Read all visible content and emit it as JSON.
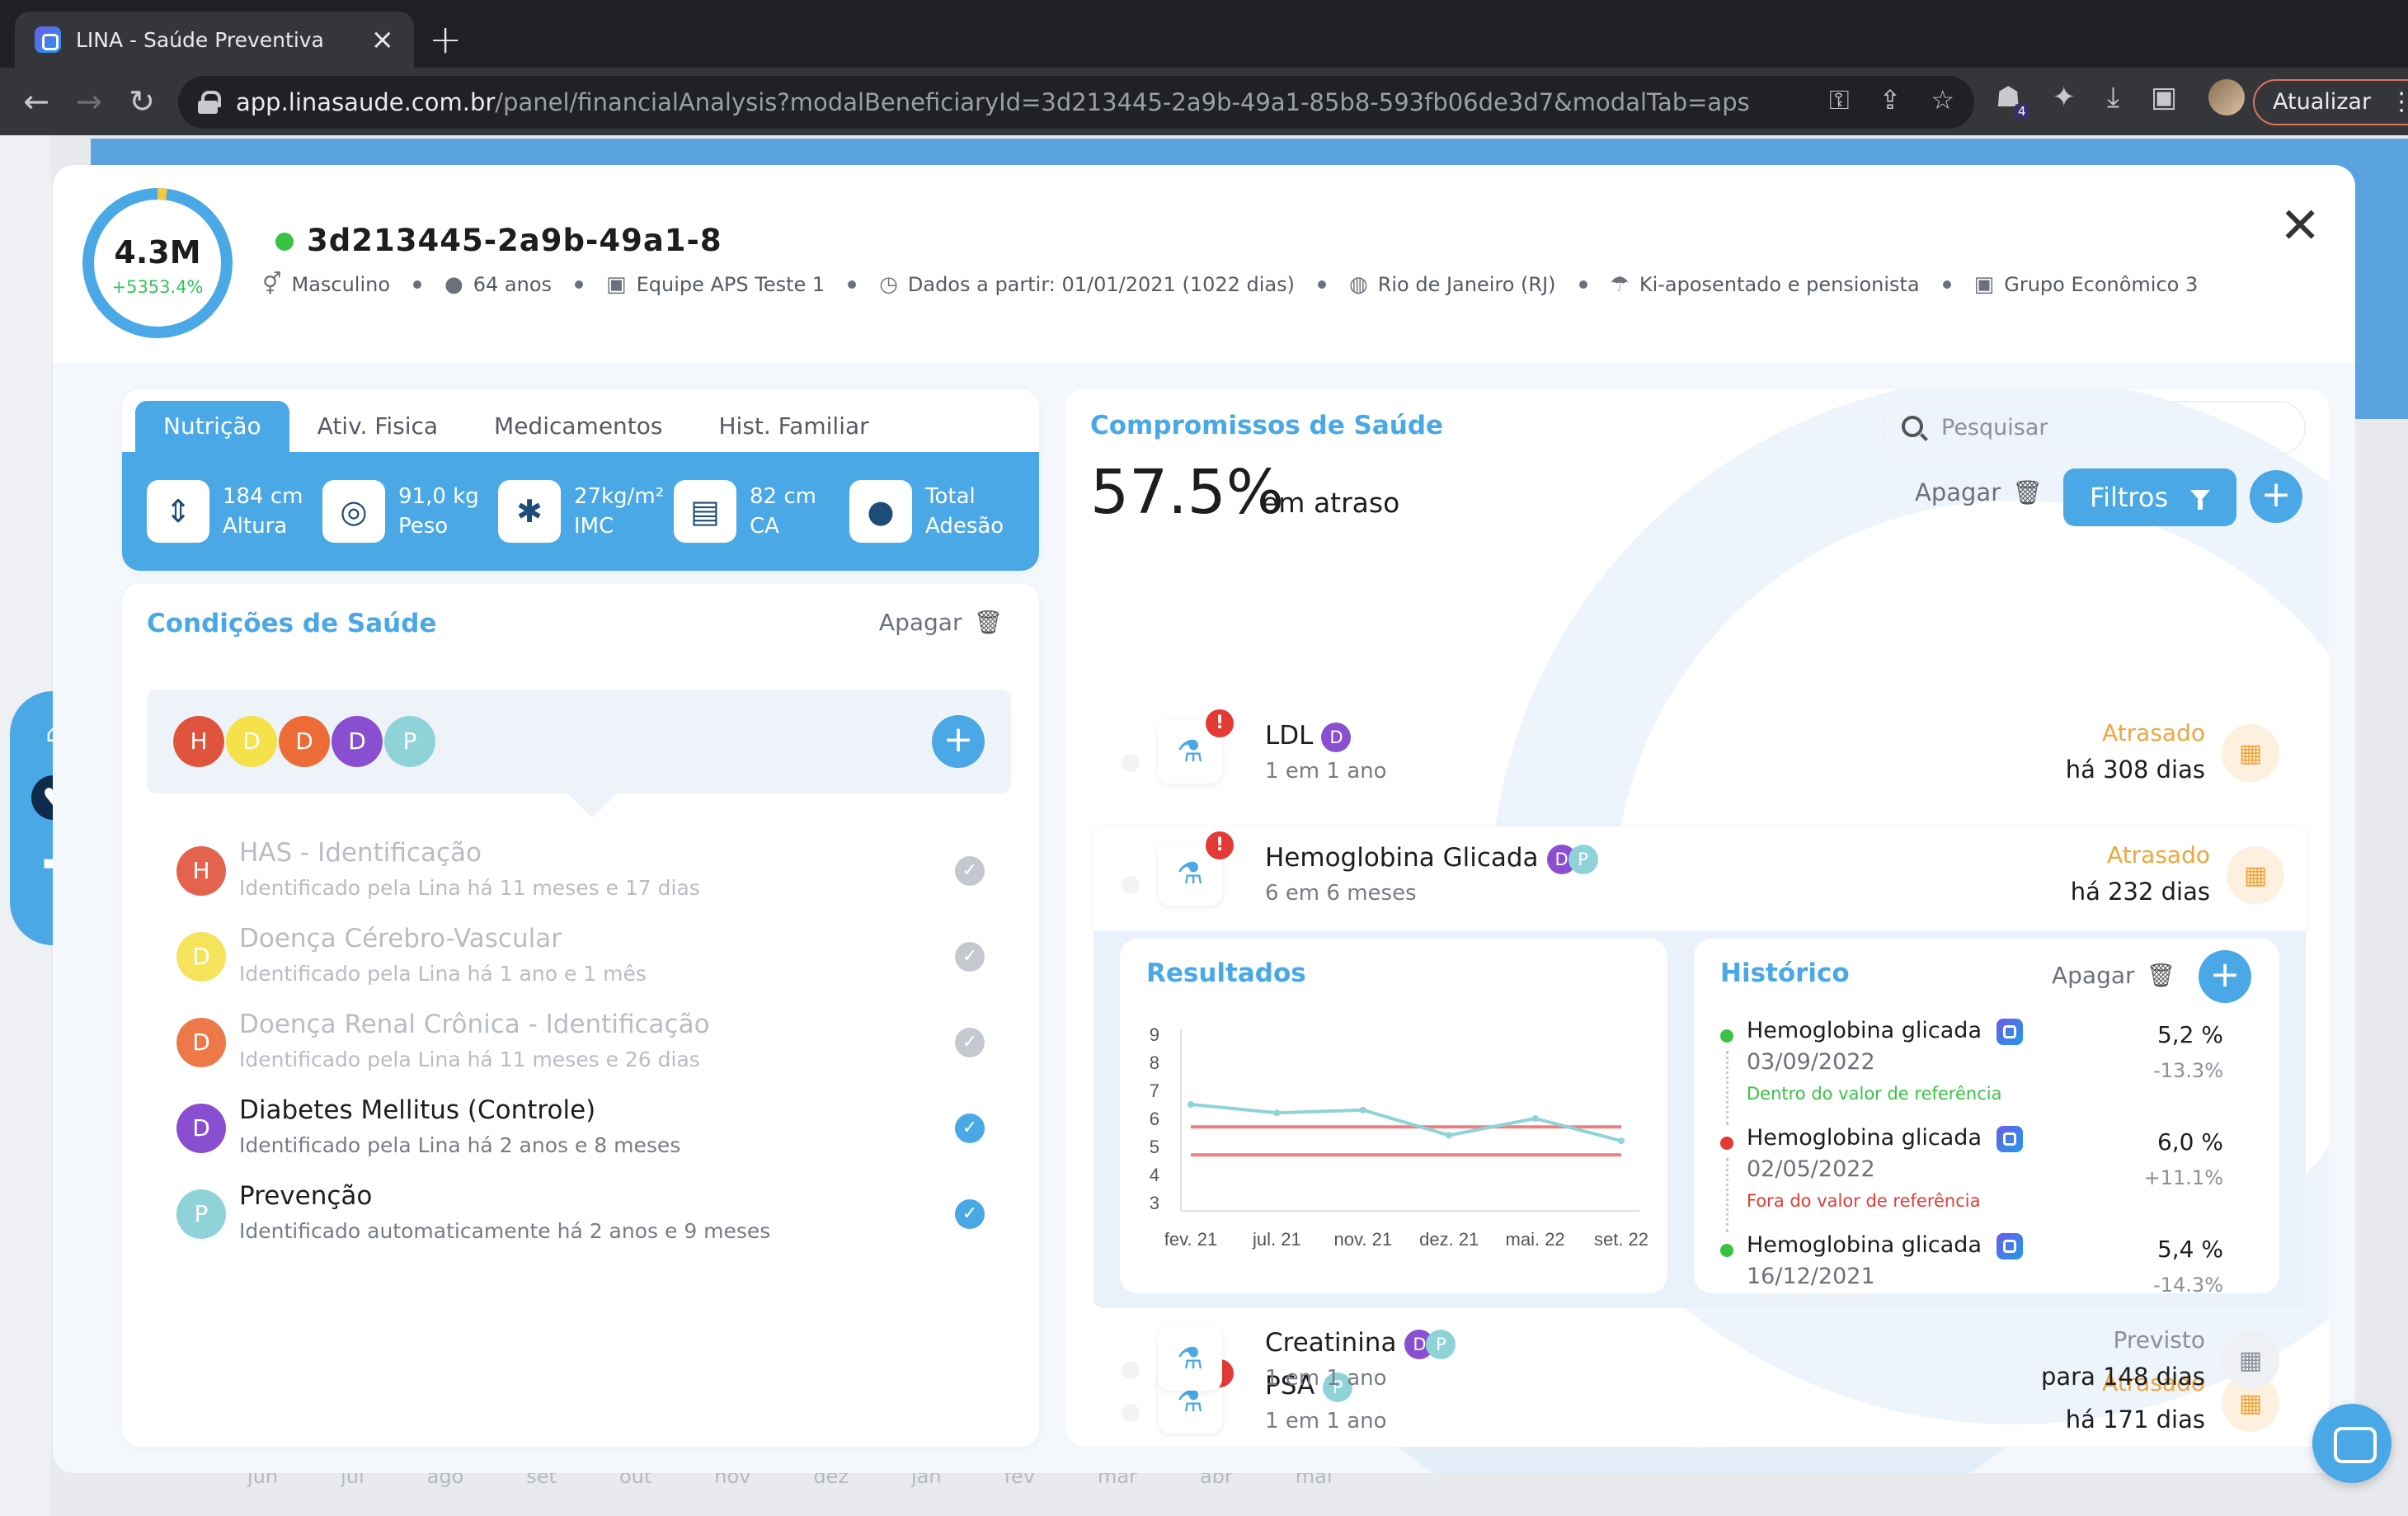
{
  "browser": {
    "tab_title": "LINA - Saúde Preventiva",
    "url_host": "app.linasaude.com.br",
    "url_path": "/panel/financialAnalysis?modalBeneficiaryId=3d213445-2a9b-49a1-85b8-593fb06de3d7&modalTab=aps",
    "update_label": "Atualizar",
    "extension_badge": "4"
  },
  "header": {
    "ring_value": "4.3M",
    "ring_delta": "+5353.4%",
    "beneficiary_id": "3d213445-2a9b-49a1-8",
    "meta": {
      "gender": "Masculino",
      "age": "64 anos",
      "team": "Equipe APS Teste 1",
      "data_from": "Dados a partir: 01/01/2021 (1022 dias)",
      "location": "Rio de Janeiro (RJ)",
      "plan": "Ki-aposentado e pensionista",
      "group": "Grupo Econômico 3"
    },
    "close_icon": "close-icon"
  },
  "left": {
    "tabs": [
      "Nutrição",
      "Ativ. Fisica",
      "Medicamentos",
      "Hist. Familiar"
    ],
    "metrics": [
      {
        "icon": "height-icon",
        "value": "184 cm",
        "label": "Altura"
      },
      {
        "icon": "scale-icon",
        "value": "91,0 kg",
        "label": "Peso"
      },
      {
        "icon": "person-icon",
        "value": "27kg/m²",
        "label": "IMC"
      },
      {
        "icon": "tape-icon",
        "value": "82 cm",
        "label": "CA"
      },
      {
        "icon": "apple-icon",
        "value": "Total",
        "label": "Adesão"
      }
    ],
    "conditions_title": "Condições de Saúde",
    "conditions_apagar": "Apagar",
    "circles": [
      "H",
      "D",
      "D",
      "D",
      "P"
    ],
    "conditions": [
      {
        "letter": "H",
        "title": "HAS - Identificação",
        "sub": "Identificado pela Lina há 11 meses e 17 dias"
      },
      {
        "letter": "D",
        "title": "Doença Cérebro-Vascular",
        "sub": "Identificado pela Lina há 1 ano e 1 mês"
      },
      {
        "letter": "D",
        "title": "Doença Renal Crônica - Identificação",
        "sub": "Identificado pela Lina há 11 meses e 26 dias"
      },
      {
        "letter": "D",
        "title": "Diabetes Mellitus (Controle)",
        "sub": "Identificado pela Lina há 2 anos e 8 meses"
      },
      {
        "letter": "P",
        "title": "Prevenção",
        "sub": "Identificado automaticamente há 2 anos e 9 meses"
      }
    ]
  },
  "right": {
    "title": "Compromissos de Saúde",
    "pct": "57.5%",
    "pct_label": "em atraso",
    "search_placeholder": "Pesquisar",
    "apagar": "Apagar",
    "filtros": "Filtros",
    "items": [
      {
        "name": "LDL",
        "freq": "1 em 1 ano",
        "status": "Atrasado",
        "detail": "há 308 dias",
        "badges": [
          "D"
        ]
      },
      {
        "name": "Hemoglobina Glicada",
        "freq": "6 em 6 meses",
        "status": "Atrasado",
        "detail": "há 232 dias",
        "badges": [
          "D",
          "P"
        ]
      },
      {
        "name": "PSA",
        "freq": "1 em 1 ano",
        "status": "Atrasado",
        "detail": "há 171 dias",
        "badges": [
          "P"
        ]
      },
      {
        "name": "Creatinina",
        "freq": "1 em 1 ano",
        "status": "Previsto",
        "detail": "para 148 dias",
        "badges": [
          "D",
          "P"
        ]
      }
    ],
    "results_title": "Resultados",
    "history_title": "Histórico",
    "history_apagar": "Apagar",
    "history": [
      {
        "name": "Hemoglobina glicada",
        "date": "03/09/2022",
        "status": "Dentro do valor de referência",
        "value": "5,2 %",
        "change": "-13.3%",
        "ok": true
      },
      {
        "name": "Hemoglobina glicada",
        "date": "02/05/2022",
        "status": "Fora do valor de referência",
        "value": "6,0 %",
        "change": "+11.1%",
        "ok": false
      },
      {
        "name": "Hemoglobina glicada",
        "date": "16/12/2021",
        "status": "",
        "value": "5,4 %",
        "change": "-14.3%",
        "ok": true
      }
    ]
  },
  "background_axis": [
    "jun",
    "jul",
    "ago",
    "set",
    "out",
    "nov",
    "dez",
    "jan",
    "fev",
    "mar",
    "abr",
    "mai"
  ],
  "colors": {
    "accent": "#4aa8e6",
    "H": "#e0533d",
    "D_yellow": "#f5e14a",
    "D_orange": "#ec6b36",
    "D_purple": "#8a4fd1",
    "P": "#8fd3d9",
    "late": "#f0a63a",
    "ok": "#3ac245",
    "bad": "#e53935"
  },
  "chart_data": {
    "type": "line",
    "title": "Resultados",
    "xlabel": "",
    "ylabel": "",
    "categories": [
      "fev. 21",
      "jul. 21",
      "nov. 21",
      "dez. 21",
      "mai. 22",
      "set. 22"
    ],
    "series": [
      {
        "values": [
          6.5,
          6.2,
          6.3,
          5.4,
          6.0,
          5.2
        ]
      }
    ],
    "reference_lines": [
      5.7,
      4.7
    ],
    "ylim": [
      3,
      9
    ],
    "yticks": [
      3,
      4,
      5,
      6,
      7,
      8,
      9
    ],
    "grid": false
  }
}
